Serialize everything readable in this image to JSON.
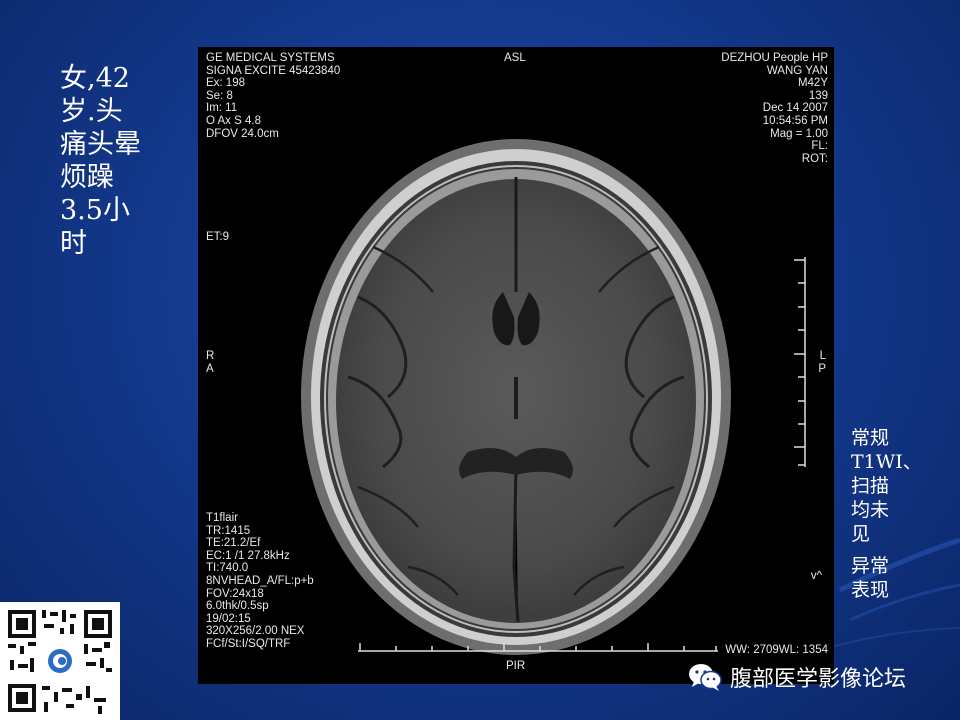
{
  "slide": {
    "left_caption_lines": [
      "女,42",
      "岁.头",
      "痛头晕",
      "烦躁",
      "3.5小",
      "时"
    ],
    "right_caption_lines": [
      "常规",
      "T1WI、",
      "扫描",
      "均未",
      "见"
    ],
    "right_caption_lines_2": [
      "异常",
      "表现"
    ],
    "background_colors": [
      "#143a8e",
      "#0a2566"
    ]
  },
  "mri": {
    "top_left": [
      "GE MEDICAL SYSTEMS",
      "SIGNA EXCITE 45423840",
      "Ex: 198",
      "Se: 8",
      "Im: 11",
      "O Ax  S 4.8",
      "DFOV 24.0cm"
    ],
    "top_center": "ASL",
    "top_right": [
      "DEZHOU People HP",
      "WANG YAN",
      "M42Y",
      "139",
      "Dec 14 2007",
      "10:54:56 PM",
      "Mag = 1.00",
      "FL:",
      "ROT:"
    ],
    "et_label": "ET:9",
    "left_orientation": [
      "R",
      "A"
    ],
    "right_orientation": [
      "L",
      "P"
    ],
    "bottom_left": [
      "T1flair",
      "TR:1415",
      "TE:21.2/Ef",
      "EC:1 /1  27.8kHz",
      "TI:740.0",
      "8NVHEAD_A/FL:p+b",
      "FOV:24x18",
      " 6.0thk/0.5sp",
      "19/02:15",
      "320X256/2.00 NEX",
      "FCf/St:I/SQ/TRF"
    ],
    "bottom_center": "PIR",
    "window_level": "WW: 2709WL: 1354",
    "v_marker": "v^"
  },
  "watermark": {
    "icon": "wechat-icon",
    "text": "腹部医学影像论坛"
  },
  "qr_code": {
    "icon": "qr-code-icon"
  }
}
